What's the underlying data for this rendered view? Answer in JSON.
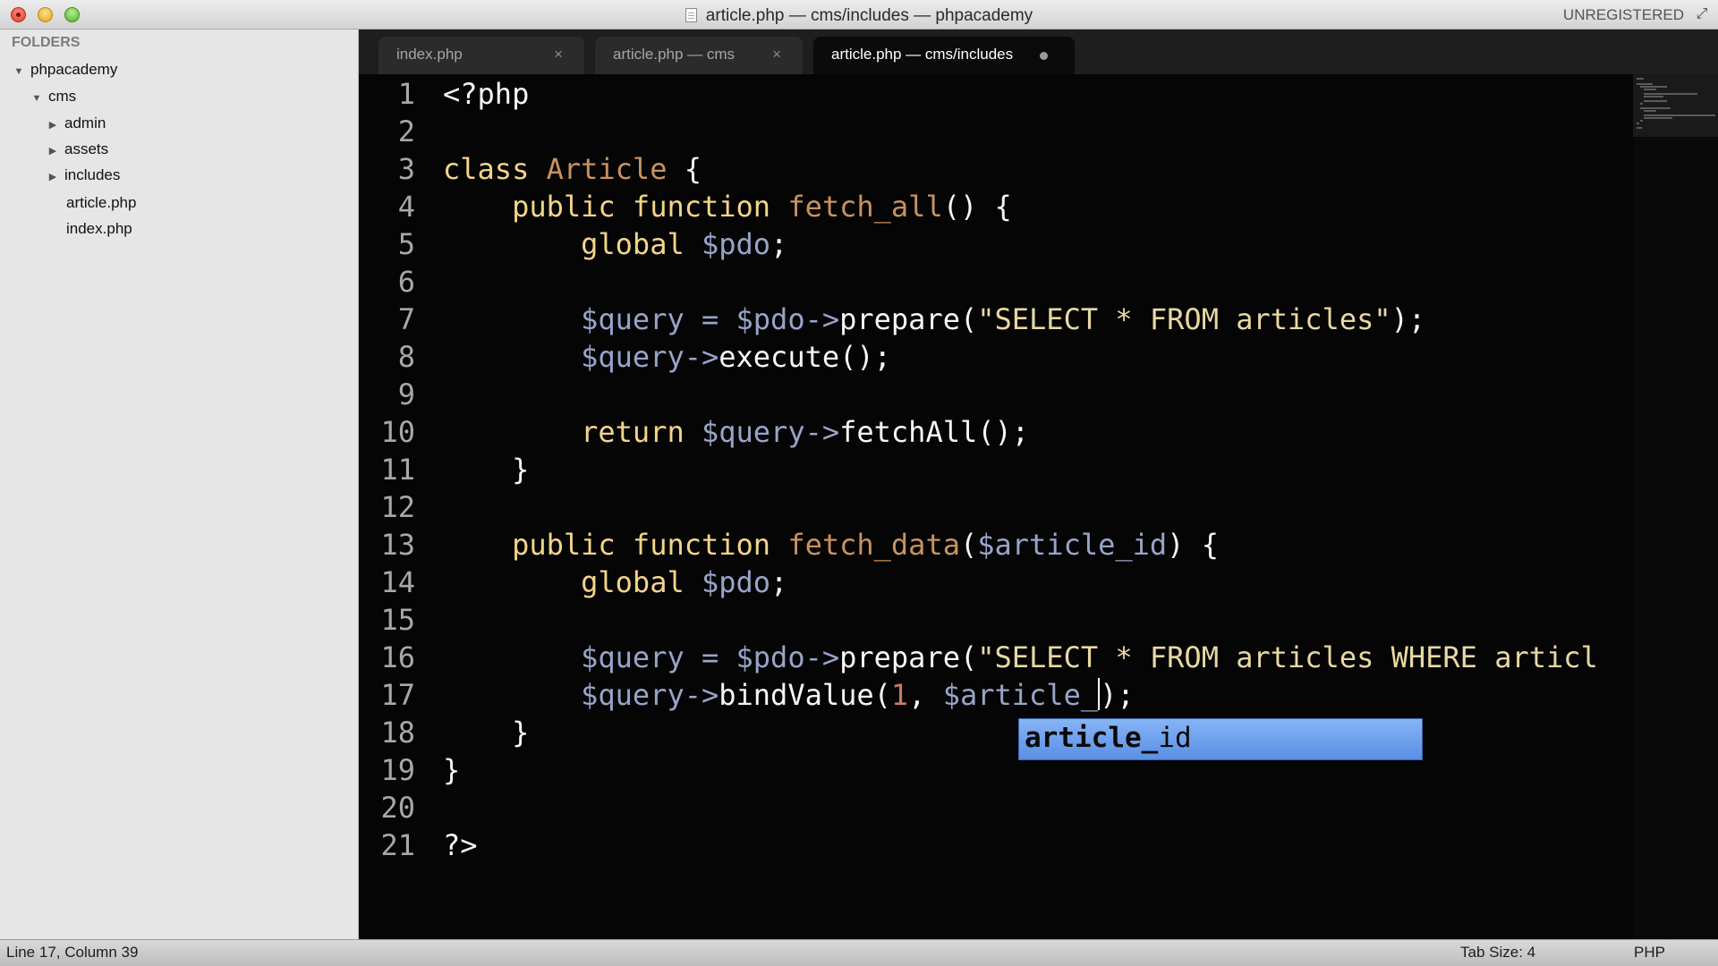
{
  "window": {
    "title": "article.php — cms/includes — phpacademy",
    "unregistered": "UNREGISTERED"
  },
  "sidebar": {
    "header": "FOLDERS",
    "tree": [
      {
        "label": "phpacademy",
        "type": "folder",
        "expanded": true
      },
      {
        "label": "cms",
        "type": "folder",
        "expanded": true
      },
      {
        "label": "admin",
        "type": "folder",
        "expanded": false
      },
      {
        "label": "assets",
        "type": "folder",
        "expanded": false
      },
      {
        "label": "includes",
        "type": "folder",
        "expanded": false
      },
      {
        "label": "article.php",
        "type": "file"
      },
      {
        "label": "index.php",
        "type": "file"
      }
    ]
  },
  "tabs": [
    {
      "label": "index.php",
      "close": "×"
    },
    {
      "label": "article.php — cms",
      "close": "×"
    },
    {
      "label": "article.php — cms/includes",
      "modified": true
    }
  ],
  "editor": {
    "line_numbers": [
      "1",
      "2",
      "3",
      "4",
      "5",
      "6",
      "7",
      "8",
      "9",
      "10",
      "11",
      "12",
      "13",
      "14",
      "15",
      "16",
      "17",
      "18",
      "19",
      "20",
      "21"
    ],
    "code": {
      "l1": "<?php",
      "class_kw": "class",
      "class_name": "Article",
      "brace_open": "{",
      "public": "public",
      "function": "function",
      "fn1": "fetch_all",
      "fn1_args": "() {",
      "global": "global",
      "pdo": "$pdo",
      "semi": ";",
      "query": "$query",
      "assign": " = ",
      "arrow": "->",
      "prepare": "prepare(",
      "sql1": "\"SELECT * FROM articles\"",
      "close_stmt": ");",
      "execute": "execute();",
      "return": "return",
      "fetchall": "fetchAll();",
      "brace_close": "}",
      "fn2": "fetch_data",
      "paren_open": "(",
      "article_id_param": "$article_id",
      "fn2_tail": ") {",
      "sql2": "\"SELECT * FROM articles WHERE articl",
      "bindvalue": "bindValue(",
      "one": "1",
      "comma": ", ",
      "typed": "$article_",
      "l21": "?>"
    },
    "autocomplete": {
      "match": "article_",
      "rest": "id"
    }
  },
  "status": {
    "position": "Line 17, Column 39",
    "tab_size": "Tab Size: 4",
    "syntax": "PHP"
  },
  "colors": {
    "keyword": "#f3d58a",
    "class_name": "#c9925e",
    "variable": "#98a4c9",
    "string": "#e8d8a4",
    "number": "#c67a6a",
    "autocomplete_bg": "#6c9ff0"
  },
  "icons": [
    "close-window-icon",
    "minimize-window-icon",
    "maximize-window-icon",
    "document-icon",
    "fullscreen-icon",
    "disclosure-triangle-icon",
    "tab-close-icon",
    "modified-dot-icon"
  ]
}
